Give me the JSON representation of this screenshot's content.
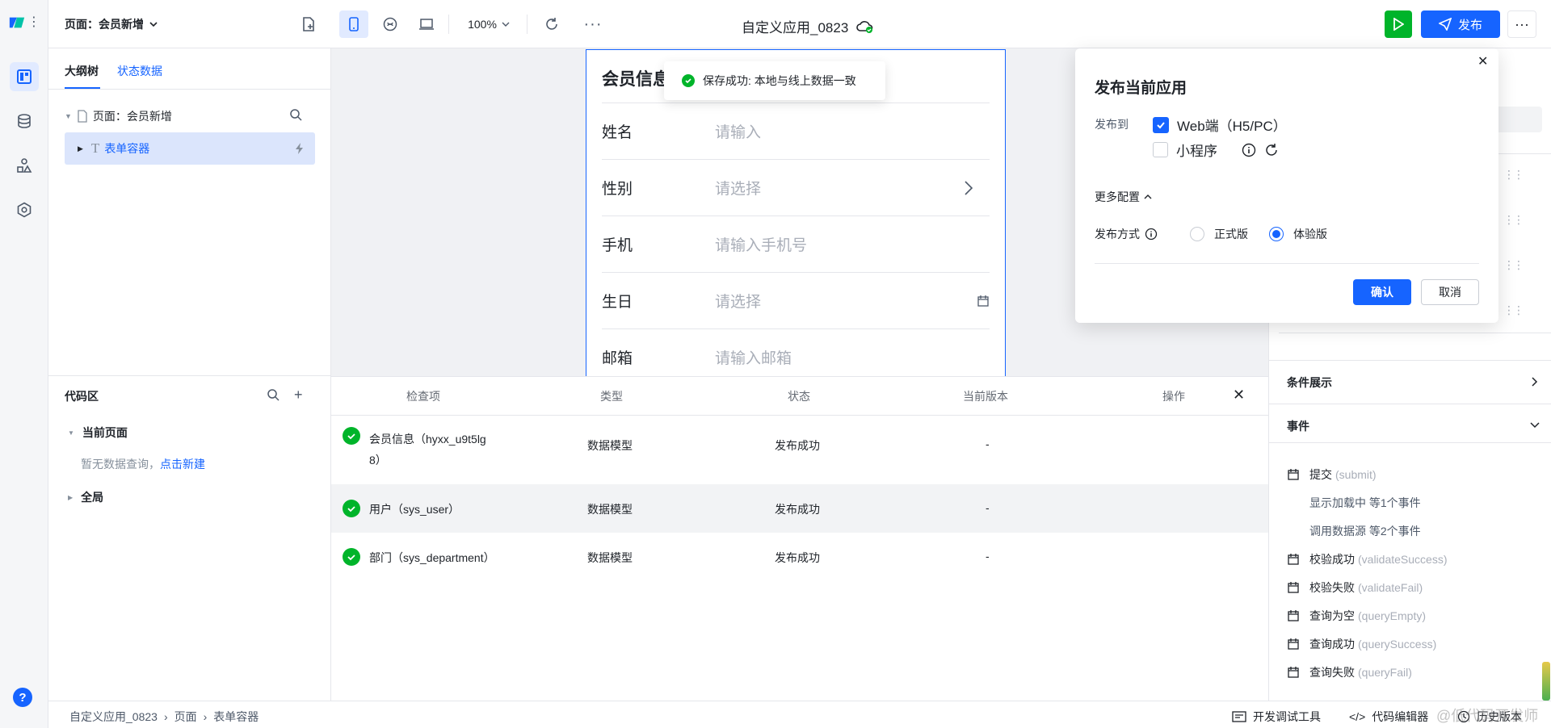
{
  "app": {
    "title": "自定义应用_0823",
    "page_selector": "页面：会员新增",
    "zoom": "100%"
  },
  "header_actions": {
    "publish_label": "发布"
  },
  "left_panel": {
    "tabs": [
      "大纲树",
      "状态数据"
    ],
    "tree": {
      "page_node": "页面：会员新增",
      "container_node": "表单容器"
    }
  },
  "code_panel": {
    "title": "代码区",
    "current_page": "当前页面",
    "empty_text": "暂无数据查询，",
    "create_link": "点击新建",
    "global": "全局"
  },
  "form": {
    "title": "会员信息",
    "fields": [
      {
        "label": "姓名",
        "placeholder": "请输入"
      },
      {
        "label": "性别",
        "placeholder": "请选择"
      },
      {
        "label": "手机",
        "placeholder": "请输入手机号"
      },
      {
        "label": "生日",
        "placeholder": "请选择"
      },
      {
        "label": "邮箱",
        "placeholder": "请输入邮箱"
      }
    ]
  },
  "toast": {
    "text": "保存成功: 本地与线上数据一致"
  },
  "check_table": {
    "headers": [
      "检查项",
      "类型",
      "状态",
      "当前版本",
      "操作"
    ],
    "rows": [
      {
        "item_line1": "会员信息（hyxx_u9t5lg",
        "item_line2": "8）",
        "type": "数据模型",
        "status": "发布成功",
        "version": "-"
      },
      {
        "item_line1": "用户（sys_user）",
        "item_line2": "",
        "type": "数据模型",
        "status": "发布成功",
        "version": "-"
      },
      {
        "item_line1": "部门（sys_department）",
        "item_line2": "",
        "type": "数据模型",
        "status": "发布成功",
        "version": "-"
      }
    ]
  },
  "popover": {
    "title": "发布当前应用",
    "publish_to_label": "发布到",
    "targets": [
      {
        "label": "Web端（H5/PC）",
        "checked": true
      },
      {
        "label": "小程序",
        "checked": false
      }
    ],
    "more_config": "更多配置",
    "method_label": "发布方式",
    "methods": [
      {
        "label": "正式版",
        "selected": false
      },
      {
        "label": "体验版",
        "selected": true
      }
    ],
    "confirm": "确认",
    "cancel": "取消"
  },
  "right_panel": {
    "condition_title": "条件展示",
    "events_title": "事件",
    "events": [
      {
        "name": "提交",
        "en": "(submit)"
      },
      {
        "name": "校验成功",
        "en": "(validateSuccess)"
      },
      {
        "name": "校验失败",
        "en": "(validateFail)"
      },
      {
        "name": "查询为空",
        "en": "(queryEmpty)"
      },
      {
        "name": "查询成功",
        "en": "(querySuccess)"
      },
      {
        "name": "查询失败",
        "en": "(queryFail)"
      }
    ],
    "submit_subs": [
      "显示加载中 等1个事件",
      "调用数据源 等2个事件"
    ]
  },
  "statusbar": {
    "breadcrumb": [
      "自定义应用_0823",
      "页面",
      "表单容器"
    ],
    "dev_tools": "开发调试工具",
    "code_editor": "代码编辑器",
    "history": "历史版本",
    "watermark": "@低代码开发师"
  },
  "colors": {
    "brand": "#1664ff",
    "success": "#00b42a",
    "play": "#00b42a"
  }
}
